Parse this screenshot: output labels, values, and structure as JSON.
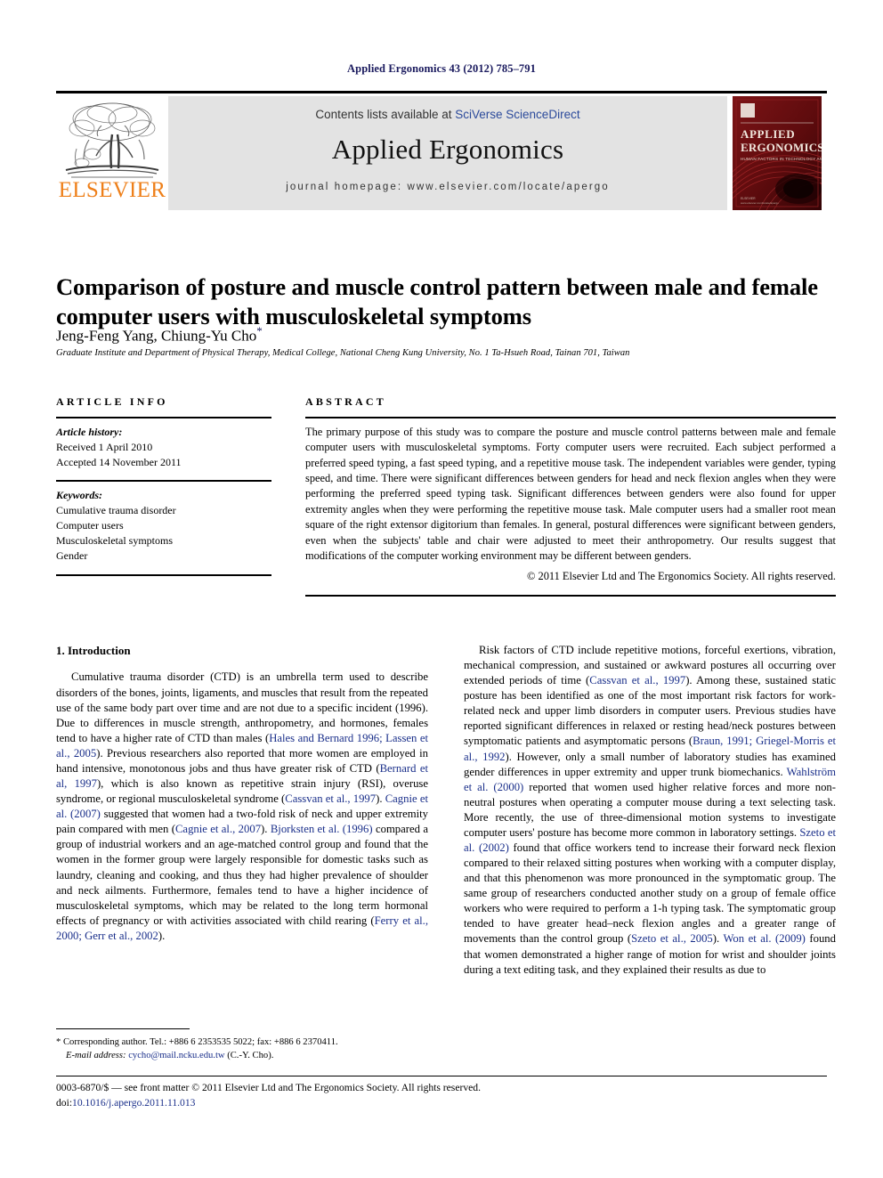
{
  "running_head": "Applied Ergonomics 43 (2012) 785–791",
  "masthead": {
    "publisher_logo_text": "ELSEVIER",
    "publisher_logo_color": "#ee7f19",
    "contents_prefix": "Contents lists available at ",
    "contents_link": "SciVerse ScienceDirect",
    "journal_name": "Applied Ergonomics",
    "homepage": "journal homepage: www.elsevier.com/locate/apergo",
    "cover": {
      "line1": "APPLIED",
      "line2": "ERGONOMICS",
      "line3": "HUMAN FACTORS IN TECHNOLOGY AND SOCIETY",
      "background_color": "#6d0f11"
    }
  },
  "article": {
    "title": "Comparison of posture and muscle control pattern between male and female computer users with musculoskeletal symptoms",
    "authors": "Jeng-Feng Yang, Chiung-Yu Cho",
    "corresponding_marker": "*",
    "affiliation": "Graduate Institute and Department of Physical Therapy, Medical College, National Cheng Kung University, No. 1 Ta-Hsueh Road, Tainan 701, Taiwan"
  },
  "article_info": {
    "heading": "ARTICLE INFO",
    "history_label": "Article history:",
    "history": [
      "Received 1 April 2010",
      "Accepted 14 November 2011"
    ],
    "keywords_label": "Keywords:",
    "keywords": [
      "Cumulative trauma disorder",
      "Computer users",
      "Musculoskeletal symptoms",
      "Gender"
    ]
  },
  "abstract": {
    "heading": "ABSTRACT",
    "text": "The primary purpose of this study was to compare the posture and muscle control patterns between male and female computer users with musculoskeletal symptoms. Forty computer users were recruited. Each subject performed a preferred speed typing, a fast speed typing, and a repetitive mouse task. The independent variables were gender, typing speed, and time. There were significant differences between genders for head and neck flexion angles when they were performing the preferred speed typing task. Significant differences between genders were also found for upper extremity angles when they were performing the repetitive mouse task. Male computer users had a smaller root mean square of the right extensor digitorium than females. In general, postural differences were significant between genders, even when the subjects' table and chair were adjusted to meet their anthropometry. Our results suggest that modifications of the computer working environment may be different between genders.",
    "copyright": "© 2011 Elsevier Ltd and The Ergonomics Society. All rights reserved."
  },
  "introduction": {
    "heading": "1. Introduction",
    "left_paragraph_html": "Cumulative trauma disorder (CTD) is an umbrella term used to describe disorders of the bones, joints, ligaments, and muscles that result from the repeated use of the same body part over time and are not due to a specific incident (1996). Due to differences in muscle strength, anthropometry, and hormones, females tend to have a higher rate of CTD than males (<span class=\"cit\">Hales and Bernard 1996; Lassen et al., 2005</span>). Previous researchers also reported that more women are employed in hand intensive, monotonous jobs and thus have greater risk of CTD (<span class=\"cit\">Bernard et al, 1997</span>), which is also known as repetitive strain injury (RSI), overuse syndrome, or regional musculoskeletal syndrome (<span class=\"cit\">Cassvan et al., 1997</span>). <span class=\"cit\">Cagnie et al. (2007)</span> suggested that women had a two-fold risk of neck and upper extremity pain compared with men (<span class=\"cit\">Cagnie et al., 2007</span>). <span class=\"cit\">Bjorksten et al. (1996)</span> compared a group of industrial workers and an age-matched control group and found that the women in the former group were largely responsible for domestic tasks such as laundry, cleaning and cooking, and thus they had higher prevalence of shoulder and neck ailments. Furthermore, females tend to have a higher incidence of musculoskeletal symptoms, which may be related to the long term hormonal effects of pregnancy or with activities associated with child rearing (<span class=\"cit\">Ferry et al., 2000; Gerr et al., 2002</span>).",
    "right_paragraph_html": "Risk factors of CTD include repetitive motions, forceful exertions, vibration, mechanical compression, and sustained or awkward postures all occurring over extended periods of time (<span class=\"cit\">Cassvan et al., 1997</span>). Among these, sustained static posture has been identified as one of the most important risk factors for work-related neck and upper limb disorders in computer users. Previous studies have reported significant differences in relaxed or resting head/neck postures between symptomatic patients and asymptomatic persons (<span class=\"cit\">Braun, 1991; Griegel-Morris et al., 1992</span>). However, only a small number of laboratory studies has examined gender differences in upper extremity and upper trunk biomechanics. <span class=\"cit\">Wahlström et al. (2000)</span> reported that women used higher relative forces and more non-neutral postures when operating a computer mouse during a text selecting task. More recently, the use of three-dimensional motion systems to investigate computer users' posture has become more common in laboratory settings. <span class=\"cit\">Szeto et al. (2002)</span> found that office workers tend to increase their forward neck flexion compared to their relaxed sitting postures when working with a computer display, and that this phenomenon was more pronounced in the symptomatic group. The same group of researchers conducted another study on a group of female office workers who were required to perform a 1-h typing task. The symptomatic group tended to have greater head–neck flexion angles and a greater range of movements than the control group (<span class=\"cit\">Szeto et al., 2005</span>). <span class=\"cit\">Won et al. (2009)</span> found that women demonstrated a higher range of motion for wrist and shoulder joints during a text editing task, and they explained their results as due to"
  },
  "footnote": {
    "marker": "*",
    "line1": "Corresponding author. Tel.: +886 6 2353535 5022; fax: +886 6 2370411.",
    "email_label": "E-mail address:",
    "email": "cycho@mail.ncku.edu.tw",
    "email_suffix": "(C.-Y. Cho)."
  },
  "colophon": {
    "line1": "0003-6870/$ — see front matter © 2011 Elsevier Ltd and The Ergonomics Society. All rights reserved.",
    "doi_label": "doi:",
    "doi": "10.1016/j.apergo.2011.11.013"
  }
}
